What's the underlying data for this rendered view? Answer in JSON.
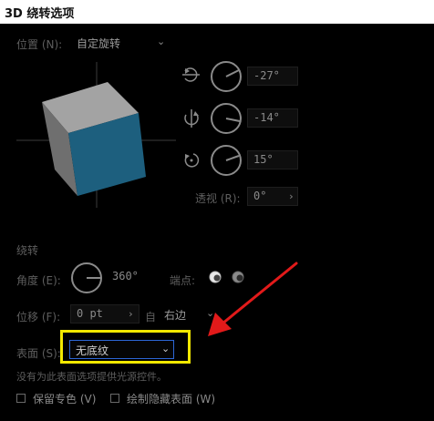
{
  "window": {
    "title": "3D 绕转选项"
  },
  "position": {
    "label": "位置 (N):",
    "value": "自定旋转"
  },
  "rotation": {
    "x": {
      "value": "-27°"
    },
    "y": {
      "value": "-14°"
    },
    "z": {
      "value": "15°"
    },
    "perspective_label": "透视 (R):",
    "perspective_value": "0°"
  },
  "revolve": {
    "section_label": "绕转",
    "angle_label": "角度 (E):",
    "angle_value": "360°",
    "cap_label": "端点:",
    "offset_label": "位移 (F):",
    "offset_value": "0 pt",
    "from_label": "自",
    "from_value": "右边"
  },
  "surface": {
    "label": "表面 (S):",
    "value": "无底纹",
    "note": "没有为此表面选项提供光源控件。"
  },
  "options": {
    "preserve_spot": "保留专色 (V)",
    "draw_hidden": "绘制隐藏表面 (W)"
  },
  "colors": {
    "highlight": "#f2e800",
    "arrow": "#e21a1a",
    "cube_front": "#1d5f7e",
    "accent": "#2c67d6"
  }
}
